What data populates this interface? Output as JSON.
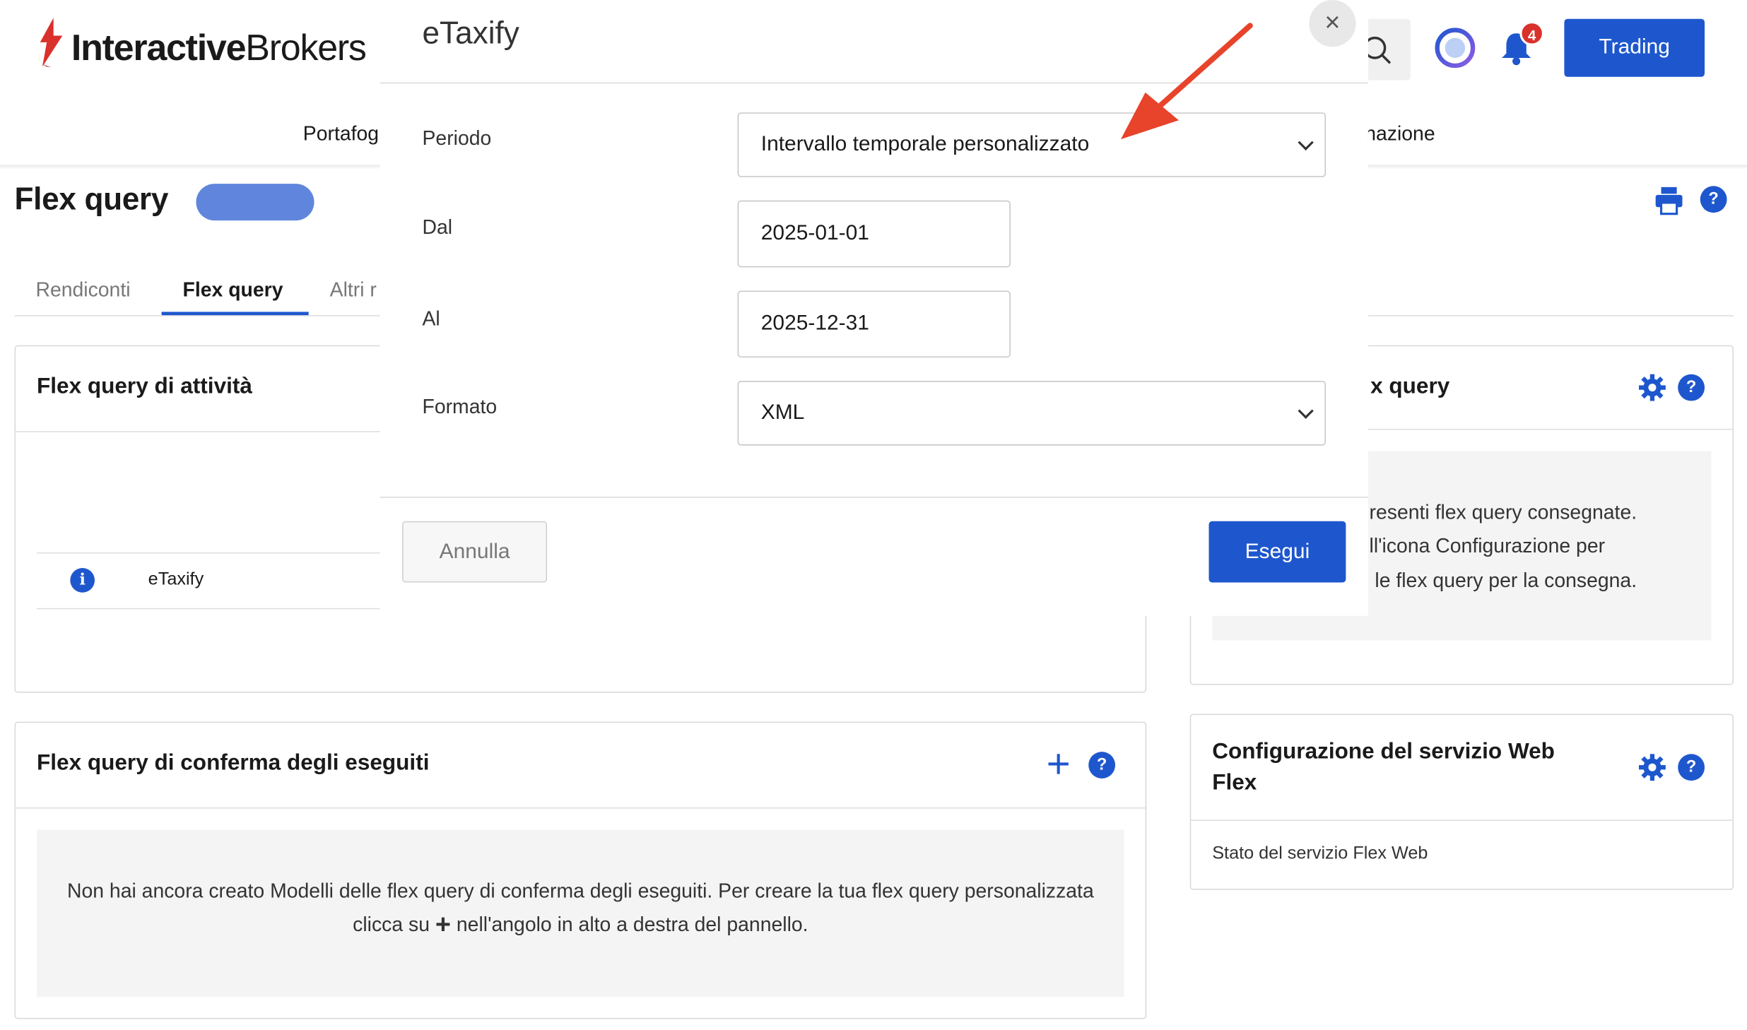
{
  "header": {
    "logo_bold": "Interactive",
    "logo_light": "Brokers",
    "notification_count": "4",
    "trading_label": "Trading",
    "nav_left": "Portafog",
    "nav_right": "nazione"
  },
  "page": {
    "title": "Flex query",
    "tabs": [
      "Rendiconti",
      "Flex query",
      "Altri r"
    ]
  },
  "activity_panel": {
    "title": "Flex query di attività",
    "rows": [
      {
        "name": "eTaxify"
      }
    ]
  },
  "confirm_panel": {
    "title": "Flex query di conferma degli eseguiti",
    "empty_before": "Non hai ancora creato Modelli delle flex query di conferma degli eseguiti. Per creare la tua flex query personalizzata clicca su",
    "empty_plus": "+",
    "empty_after": "nell'angolo in alto a destra del pannello."
  },
  "delivery_panel": {
    "title_partial": "x query",
    "text_lines": [
      "resenti flex query consegnate.",
      "ll'icona Configurazione per",
      "le flex query per la consegna."
    ]
  },
  "web_panel": {
    "title": "Configurazione del servizio Web Flex",
    "status_label": "Stato del servizio Flex Web"
  },
  "modal": {
    "title": "eTaxify",
    "close_glyph": "×",
    "fields": {
      "period_label": "Periodo",
      "period_value": "Intervallo temporale personalizzato",
      "from_label": "Dal",
      "from_value": "2025-01-01",
      "to_label": "Al",
      "to_value": "2025-12-31",
      "format_label": "Formato",
      "format_value": "XML"
    },
    "cancel_label": "Annulla",
    "run_label": "Esegui"
  },
  "icons": [
    "logo-icon",
    "search-icon",
    "assistant-icon",
    "bell-icon",
    "print-icon",
    "help-icon",
    "info-icon",
    "plus-icon",
    "gear-icon",
    "close-icon",
    "chevron-down-icon",
    "annotation-arrow"
  ],
  "colors": {
    "accent": "#1e57cd",
    "brand_red": "#d9312b",
    "annotation": "#e8432b"
  }
}
